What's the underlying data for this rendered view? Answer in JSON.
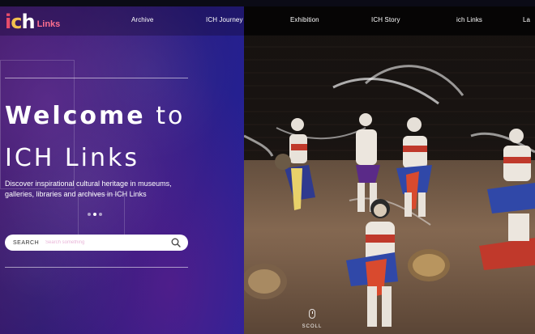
{
  "logo": {
    "ich_i": "i",
    "ich_c": "c",
    "ich_h": "h",
    "text": "Links"
  },
  "nav": {
    "items": [
      {
        "label": "Archive"
      },
      {
        "label": "ICH Journey"
      },
      {
        "label": "Exhibition"
      },
      {
        "label": "ICH Story"
      },
      {
        "label": "ich Links"
      },
      {
        "label": "La"
      }
    ]
  },
  "hero": {
    "title_line1_bold": "Welcome",
    "title_line1_light": "to",
    "title_line2": "ICH Links",
    "description": "Discover inspirational cultural heritage in museums, galleries, libraries and archives in ICH Links",
    "slide_count": 3,
    "active_slide": 2
  },
  "search": {
    "label": "SEARCH",
    "placeholder": "Search something",
    "icon": "search-icon"
  },
  "scroll": {
    "label": "SCOLL",
    "icon": "mouse-icon"
  },
  "colors": {
    "panel_purple": "#2c1a78",
    "panel_blue": "#22239a",
    "logo_pink": "#ff6f8f",
    "logo_yellow": "#f2c14e",
    "logo_red": "#e74c6a",
    "placeholder_pink": "#e9b4d8"
  }
}
